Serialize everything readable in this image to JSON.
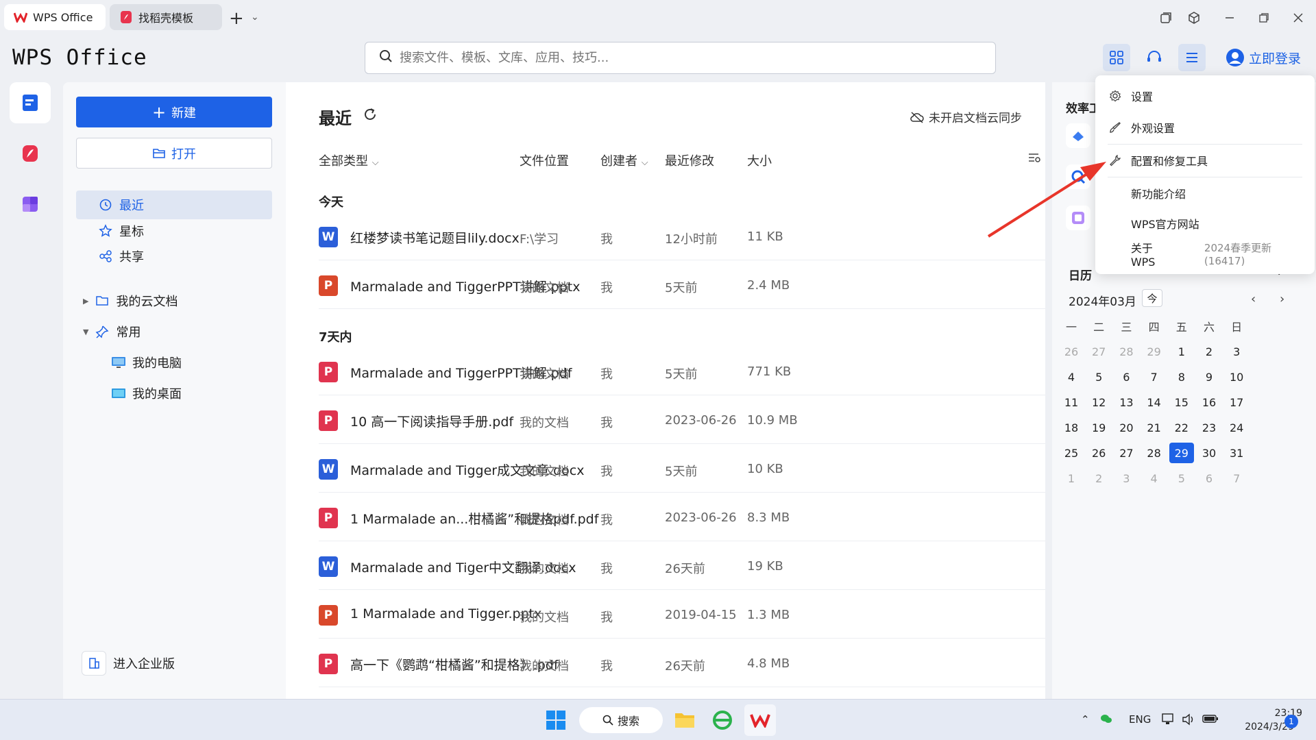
{
  "tabs": [
    {
      "label": "WPS Office"
    },
    {
      "label": "找稻壳模板"
    }
  ],
  "header": {
    "logo_text": "WPS Office",
    "search_placeholder": "搜索文件、模板、文库、应用、技巧...",
    "login_label": "立即登录"
  },
  "nav": {
    "new_label": "新建",
    "open_label": "打开",
    "items": [
      {
        "label": "最近"
      },
      {
        "label": "星标"
      },
      {
        "label": "共享"
      }
    ],
    "tree": [
      {
        "label": "我的云文档"
      },
      {
        "label": "常用"
      },
      {
        "label": "我的电脑"
      },
      {
        "label": "我的桌面"
      }
    ],
    "enterprise_label": "进入企业版"
  },
  "main": {
    "title": "最近",
    "cloud_sync_label": "未开启文档云同步",
    "columns": {
      "type": "全部类型",
      "location": "文件位置",
      "creator": "创建者",
      "modified": "最近修改",
      "size": "大小"
    },
    "groups": [
      {
        "label": "今天",
        "files": [
          {
            "icon": "W",
            "kind": "word",
            "name": "红楼梦读书笔记题目lily.docx",
            "location": "F:\\学习",
            "creator": "我",
            "modified": "12小时前",
            "size": "11 KB"
          },
          {
            "icon": "P",
            "kind": "ppt",
            "name": "Marmalade and TiggerPPT讲解.pptx",
            "location": "我的文档",
            "creator": "我",
            "modified": "5天前",
            "size": "2.4 MB"
          }
        ]
      },
      {
        "label": "7天内",
        "files": [
          {
            "icon": "P",
            "kind": "pdf",
            "name": "Marmalade and TiggerPPT讲解.pdf",
            "location": "我的文档",
            "creator": "我",
            "modified": "5天前",
            "size": "771 KB"
          },
          {
            "icon": "P",
            "kind": "pdf",
            "name": "10 高一下阅读指导手册.pdf",
            "location": "我的文档",
            "creator": "我",
            "modified": "2023-06-26",
            "size": "10.9 MB"
          },
          {
            "icon": "W",
            "kind": "word",
            "name": "Marmalade and Tigger成文文章.docx",
            "location": "我的文档",
            "creator": "我",
            "modified": "5天前",
            "size": "10 KB"
          },
          {
            "icon": "P",
            "kind": "pdf",
            "name": "1 Marmalade an...柑橘酱”和提格pdf.pdf",
            "location": "我的文档",
            "creator": "我",
            "modified": "2023-06-26",
            "size": "8.3 MB"
          },
          {
            "icon": "W",
            "kind": "word",
            "name": "Marmalade and Tiger中文翻译.docx",
            "location": "我的文档",
            "creator": "我",
            "modified": "26天前",
            "size": "19 KB"
          },
          {
            "icon": "P",
            "kind": "ppt",
            "name": "1 Marmalade and Tigger.pptx",
            "location": "我的文档",
            "creator": "我",
            "modified": "2019-04-15",
            "size": "1.3 MB"
          },
          {
            "icon": "P",
            "kind": "pdf",
            "name": "高一下《鹦鹉“柑橘酱”和提格》.pdf",
            "location": "我的文档",
            "creator": "我",
            "modified": "26天前",
            "size": "4.8 MB"
          }
        ]
      }
    ]
  },
  "right": {
    "efficiency_title": "效率工",
    "calendar_title": "日历",
    "calendar_add": "+",
    "month_label": "2024年03月",
    "today_label": "今",
    "weekdays": [
      "一",
      "二",
      "三",
      "四",
      "五",
      "六",
      "日"
    ],
    "days": [
      "26",
      "27",
      "28",
      "29",
      "1",
      "2",
      "3",
      "4",
      "5",
      "6",
      "7",
      "8",
      "9",
      "10",
      "11",
      "12",
      "13",
      "14",
      "15",
      "16",
      "17",
      "18",
      "19",
      "20",
      "21",
      "22",
      "23",
      "24",
      "25",
      "26",
      "27",
      "28",
      "29",
      "30",
      "31",
      "1",
      "2",
      "3",
      "4",
      "5",
      "6",
      "7"
    ],
    "selected_day": "29"
  },
  "menu": {
    "items": [
      {
        "label": "设置",
        "icon": "gear-icon"
      },
      {
        "label": "外观设置",
        "icon": "brush-icon"
      },
      {
        "label": "配置和修复工具",
        "icon": "wrench-icon"
      },
      {
        "label": "新功能介绍"
      },
      {
        "label": "WPS官方网站"
      },
      {
        "label": "关于WPS"
      }
    ],
    "update_label": "2024春季更新 (16417)"
  },
  "taskbar": {
    "search_label": "搜索",
    "lang": "ENG",
    "time": "23:19",
    "date": "2024/3/29",
    "notifications": "1"
  },
  "colors": {
    "accent": "#1e62e6",
    "word": "#2b5fd9",
    "ppt": "#d9482b",
    "pdf": "#e0344f",
    "arrow": "#e8352a"
  }
}
